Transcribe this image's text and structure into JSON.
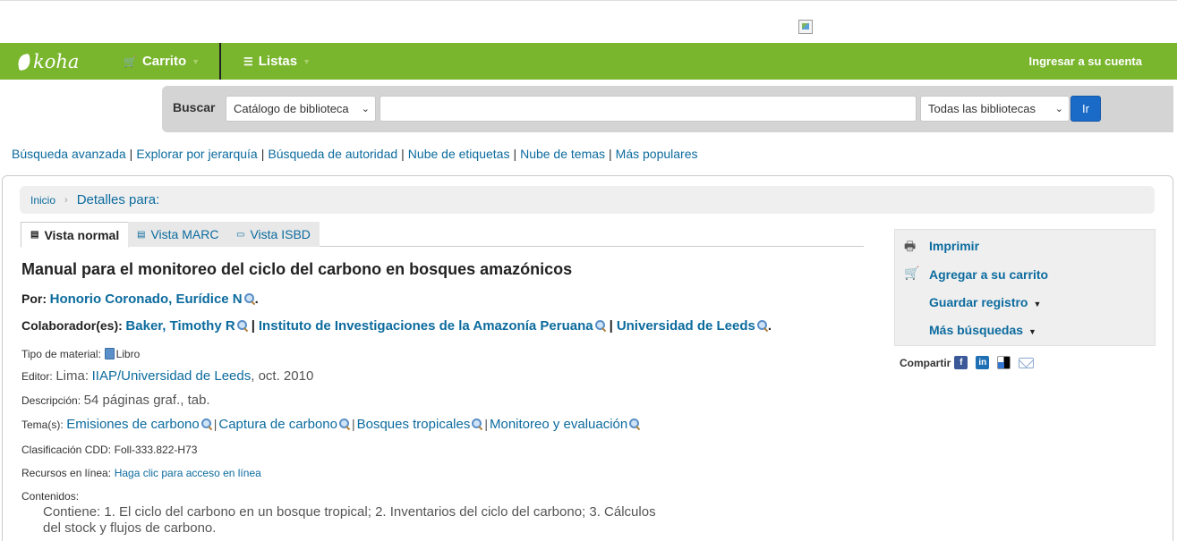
{
  "navbar": {
    "logo": "koha",
    "cart": "Carrito",
    "lists": "Listas",
    "login": "Ingresar a su cuenta"
  },
  "search": {
    "label": "Buscar",
    "catalog_select": "Catálogo de biblioteca",
    "library_select": "Todas las bibliotecas",
    "go": "Ir",
    "query_value": ""
  },
  "more_searches": [
    "Búsqueda avanzada",
    "Explorar por jerarquía",
    "Búsqueda de autoridad",
    "Nube de etiquetas",
    "Nube de temas",
    "Más populares"
  ],
  "breadcrumb": {
    "home": "Inicio",
    "current": "Detalles para:"
  },
  "tabs": [
    "Vista normal",
    "Vista MARC",
    "Vista ISBD"
  ],
  "record": {
    "title": "Manual para el monitoreo del ciclo del carbono en bosques amazónicos",
    "by_label": "Por:",
    "author": "Honorio Coronado, Eurídice N",
    "contrib_label": "Colaborador(es):",
    "contributors": [
      "Baker, Timothy R",
      "Instituto de Investigaciones de la Amazonía Peruana",
      "Universidad de Leeds"
    ],
    "material_label": "Tipo de material:",
    "material": "Libro",
    "publisher_label": "Editor:",
    "publisher_place": "Lima:",
    "publisher": "IIAP/Universidad de Leeds",
    "publisher_date": ", oct. 2010",
    "description_label": "Descripción:",
    "description": "54 páginas graf., tab.",
    "subjects_label": "Tema(s):",
    "subjects": [
      "Emisiones de carbono",
      "Captura de carbono",
      "Bosques tropicales",
      "Monitoreo y evaluación"
    ],
    "ddc_label": "Clasificación CDD:",
    "ddc": "Foll-333.822-H73",
    "online_label": "Recursos en línea:",
    "online": "Haga clic para acceso en línea",
    "contents_label": "Contenidos:",
    "contents": "Contiene: 1. El ciclo del carbono en un bosque tropical; 2. Inventarios del ciclo del carbono; 3. Cálculos del stock y flujos de carbono."
  },
  "sidebar": {
    "print": "Imprimir",
    "add_cart": "Agregar a su carrito",
    "save": "Guardar registro",
    "more": "Más búsquedas",
    "share_label": "Compartir"
  }
}
